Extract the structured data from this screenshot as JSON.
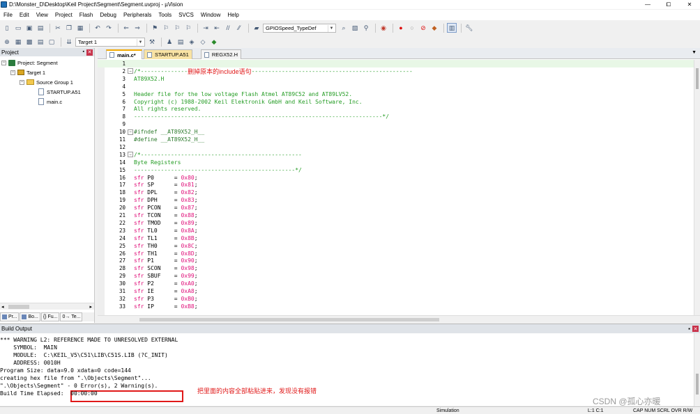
{
  "window": {
    "title": "D:\\Monster_D\\Desktop\\Keil Project\\Segment\\Segment.uvproj - µVision",
    "controls": [
      "—",
      "⧠",
      "✕"
    ]
  },
  "menu": [
    "File",
    "Edit",
    "View",
    "Project",
    "Flash",
    "Debug",
    "Peripherals",
    "Tools",
    "SVCS",
    "Window",
    "Help"
  ],
  "toolbar1": {
    "combo_value": "GPIOSpeed_TypeDef"
  },
  "toolbar2": {
    "target_combo": "Target 1"
  },
  "project_panel": {
    "title": "Project",
    "tree": [
      {
        "label": "Project: Segment"
      },
      {
        "label": "Target 1"
      },
      {
        "label": "Source Group 1"
      },
      {
        "label": "STARTUP.A51"
      },
      {
        "label": "main.c"
      }
    ],
    "tabs": [
      "Pr...",
      "Bo...",
      "{} Fu...",
      "0→ Te..."
    ]
  },
  "editor": {
    "tabs": [
      "main.c*",
      "STARTUP.A51",
      "REGX52.H"
    ],
    "annotation": "删掉原本的include语句",
    "lines": [
      {
        "n": "1",
        "text": ""
      },
      {
        "n": "2",
        "text": "/*--------------"
      },
      {
        "n": "3",
        "text": "AT89X52.H"
      },
      {
        "n": "4",
        "text": ""
      },
      {
        "n": "5",
        "text": "Header file for the low voltage Flash Atmel AT89C52 and AT89LV52."
      },
      {
        "n": "6",
        "text": "Copyright (c) 1988-2002 Keil Elektronik GmbH and Keil Software, Inc."
      },
      {
        "n": "7",
        "text": "All rights reserved."
      },
      {
        "n": "8",
        "text": "--------------------------------------------------------------------------*/"
      },
      {
        "n": "9",
        "text": ""
      },
      {
        "n": "10",
        "text": "#ifndef __AT89X52_H__"
      },
      {
        "n": "11",
        "text": "#define __AT89X52_H__"
      },
      {
        "n": "12",
        "text": ""
      },
      {
        "n": "13",
        "text": "/*------------------------------------------------"
      },
      {
        "n": "14",
        "text": "Byte Registers"
      },
      {
        "n": "15",
        "text": "------------------------------------------------*/"
      },
      {
        "n": "16",
        "kw": "sfr",
        "name": " P0      = ",
        "val": "0x80",
        "end": ";"
      },
      {
        "n": "17",
        "kw": "sfr",
        "name": " SP      = ",
        "val": "0x81",
        "end": ";"
      },
      {
        "n": "18",
        "kw": "sfr",
        "name": " DPL     = ",
        "val": "0x82",
        "end": ";"
      },
      {
        "n": "19",
        "kw": "sfr",
        "name": " DPH     = ",
        "val": "0x83",
        "end": ";"
      },
      {
        "n": "20",
        "kw": "sfr",
        "name": " PCON    = ",
        "val": "0x87",
        "end": ";"
      },
      {
        "n": "21",
        "kw": "sfr",
        "name": " TCON    = ",
        "val": "0x88",
        "end": ";"
      },
      {
        "n": "22",
        "kw": "sfr",
        "name": " TMOD    = ",
        "val": "0x89",
        "end": ";"
      },
      {
        "n": "23",
        "kw": "sfr",
        "name": " TL0     = ",
        "val": "0x8A",
        "end": ";"
      },
      {
        "n": "24",
        "kw": "sfr",
        "name": " TL1     = ",
        "val": "0x8B",
        "end": ";"
      },
      {
        "n": "25",
        "kw": "sfr",
        "name": " TH0     = ",
        "val": "0x8C",
        "end": ";"
      },
      {
        "n": "26",
        "kw": "sfr",
        "name": " TH1     = ",
        "val": "0x8D",
        "end": ";"
      },
      {
        "n": "27",
        "kw": "sfr",
        "name": " P1      = ",
        "val": "0x90",
        "end": ";"
      },
      {
        "n": "28",
        "kw": "sfr",
        "name": " SCON    = ",
        "val": "0x98",
        "end": ";"
      },
      {
        "n": "29",
        "kw": "sfr",
        "name": " SBUF    = ",
        "val": "0x99",
        "end": ";"
      },
      {
        "n": "30",
        "kw": "sfr",
        "name": " P2      = ",
        "val": "0xA0",
        "end": ";"
      },
      {
        "n": "31",
        "kw": "sfr",
        "name": " IE      = ",
        "val": "0xA8",
        "end": ";"
      },
      {
        "n": "32",
        "kw": "sfr",
        "name": " P3      = ",
        "val": "0xB0",
        "end": ";"
      },
      {
        "n": "33",
        "kw": "sfr",
        "name": " IP      = ",
        "val": "0xB8",
        "end": ";"
      }
    ]
  },
  "build_output": {
    "title": "Build Output",
    "lines": [
      "*** WARNING L2: REFERENCE MADE TO UNRESOLVED EXTERNAL",
      "    SYMBOL:  MAIN",
      "    MODULE:  C:\\KEIL_V5\\C51\\LIB\\C51S.LIB (?C_INIT)",
      "    ADDRESS: 0010H",
      "Program Size: data=9.0 xdata=0 code=144",
      "creating hex file from \".\\Objects\\Segment\"...",
      "\".\\Objects\\Segment\" - 0 Error(s), 2 Warning(s).",
      "Build Time Elapsed:  00:00:00"
    ],
    "annotation": "把里面的内容全部粘贴进来，发现没有报错"
  },
  "watermark": "CSDN @孤心亦暖",
  "status": {
    "mode": "Simulation",
    "position": "L:1 C:1",
    "flags": "CAP  NUM  SCRL  OVR  R/W"
  },
  "colors": {
    "comment": "#249c24",
    "keyword": "#e0107a",
    "annotation": "#e01818",
    "current_line": "#e8f7e6"
  }
}
